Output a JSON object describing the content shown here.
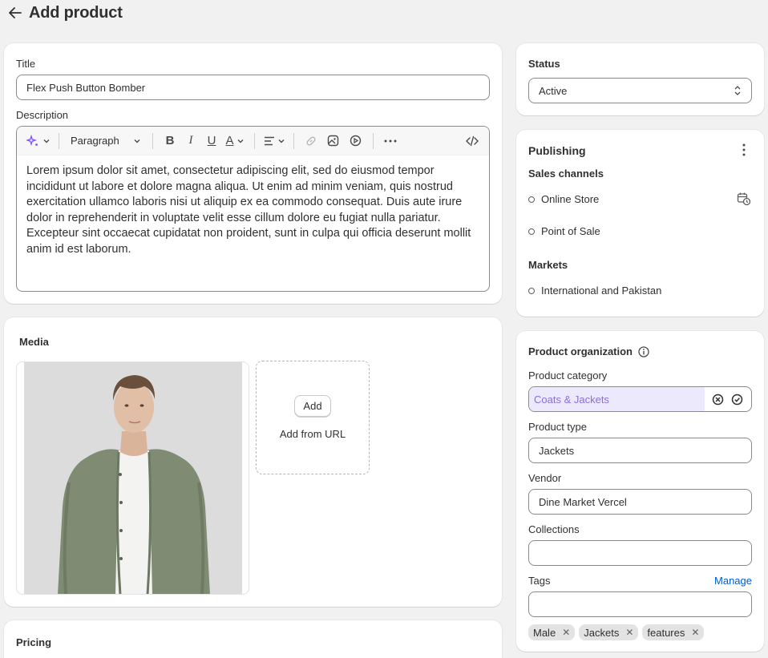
{
  "page": {
    "title": "Add product"
  },
  "details": {
    "title_label": "Title",
    "title_value": "Flex Push Button Bomber",
    "description_label": "Description",
    "toolbar": {
      "paragraph_label": "Paragraph"
    },
    "description_paragraph_parts": [
      "Lorem ipsum dolor sit amet, consectetur adipiscing elit, sed do eiusmod tempor incididunt ut labore et dolore magna aliqua. Ut enim ad minim veniam, quis nostrud exercitation ullamco laboris nisi ut aliquip ex ea commodo consequat. Duis aute irure dolor in reprehenderit in voluptate velit esse cillum dolore eu fugiat nulla pariatur. Excepteur sint occaecat cupidatat non proident, sunt in culpa qui officia deserunt mollit anim id est laborum."
    ]
  },
  "media": {
    "title": "Media",
    "add_button": "Add",
    "add_from_url": "Add from URL"
  },
  "pricing": {
    "title": "Pricing"
  },
  "status": {
    "title": "Status",
    "value": "Active"
  },
  "publishing": {
    "title": "Publishing",
    "sales_channels_label": "Sales channels",
    "channels": [
      "Online Store",
      "Point of Sale"
    ],
    "markets_label": "Markets",
    "markets": [
      "International and Pakistan"
    ]
  },
  "organization": {
    "title": "Product organization",
    "category_label": "Product category",
    "category_value": "Coats & Jackets",
    "type_label": "Product type",
    "type_value": "Jackets",
    "vendor_label": "Vendor",
    "vendor_value": "Dine Market Vercel",
    "collections_label": "Collections",
    "collections_value": "",
    "tags_label": "Tags",
    "tags_manage": "Manage",
    "tags_value": "",
    "tags": [
      "Male",
      "Jackets",
      "features"
    ]
  },
  "colors": {
    "accent_link": "#005bd3",
    "category_fill": "#ece9fd",
    "category_text": "#8a6ee0"
  }
}
